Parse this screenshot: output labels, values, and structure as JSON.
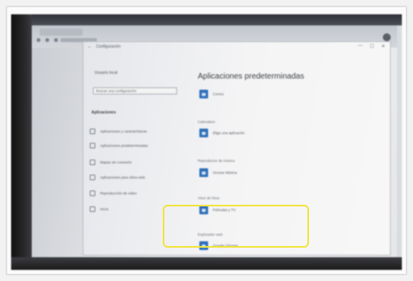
{
  "window": {
    "title": "Configuración",
    "back_glyph": "←",
    "minimize_glyph": "—",
    "maximize_glyph": "☐",
    "close_glyph": "✕"
  },
  "sidebar": {
    "profile_name": "Usuario local",
    "search_placeholder": "Buscar una configuración",
    "section_title": "Aplicaciones",
    "items": [
      {
        "label": "Aplicaciones y características",
        "icon": "apps-list-icon"
      },
      {
        "label": "Aplicaciones predeterminadas",
        "icon": "default-apps-icon"
      },
      {
        "label": "Mapas sin conexión",
        "icon": "map-icon"
      },
      {
        "label": "Aplicaciones para sitios web",
        "icon": "link-icon"
      },
      {
        "label": "Reproducción de vídeo",
        "icon": "video-icon"
      },
      {
        "label": "Inicio",
        "icon": "startup-icon"
      }
    ]
  },
  "content": {
    "title": "Aplicaciones predeterminadas",
    "groups": [
      {
        "label": "",
        "app": "Correo"
      },
      {
        "label": "Calendario",
        "app": "Elige una aplicación"
      },
      {
        "label": "Reproductor de música",
        "app": "Groove Música"
      },
      {
        "label": "Visor de fotos",
        "app": "Películas y TV"
      },
      {
        "label": "Explorador web",
        "app": "Google Chrome"
      }
    ]
  },
  "colors": {
    "highlight": "#f1e43a",
    "app_tile": "#2f6fb8"
  }
}
